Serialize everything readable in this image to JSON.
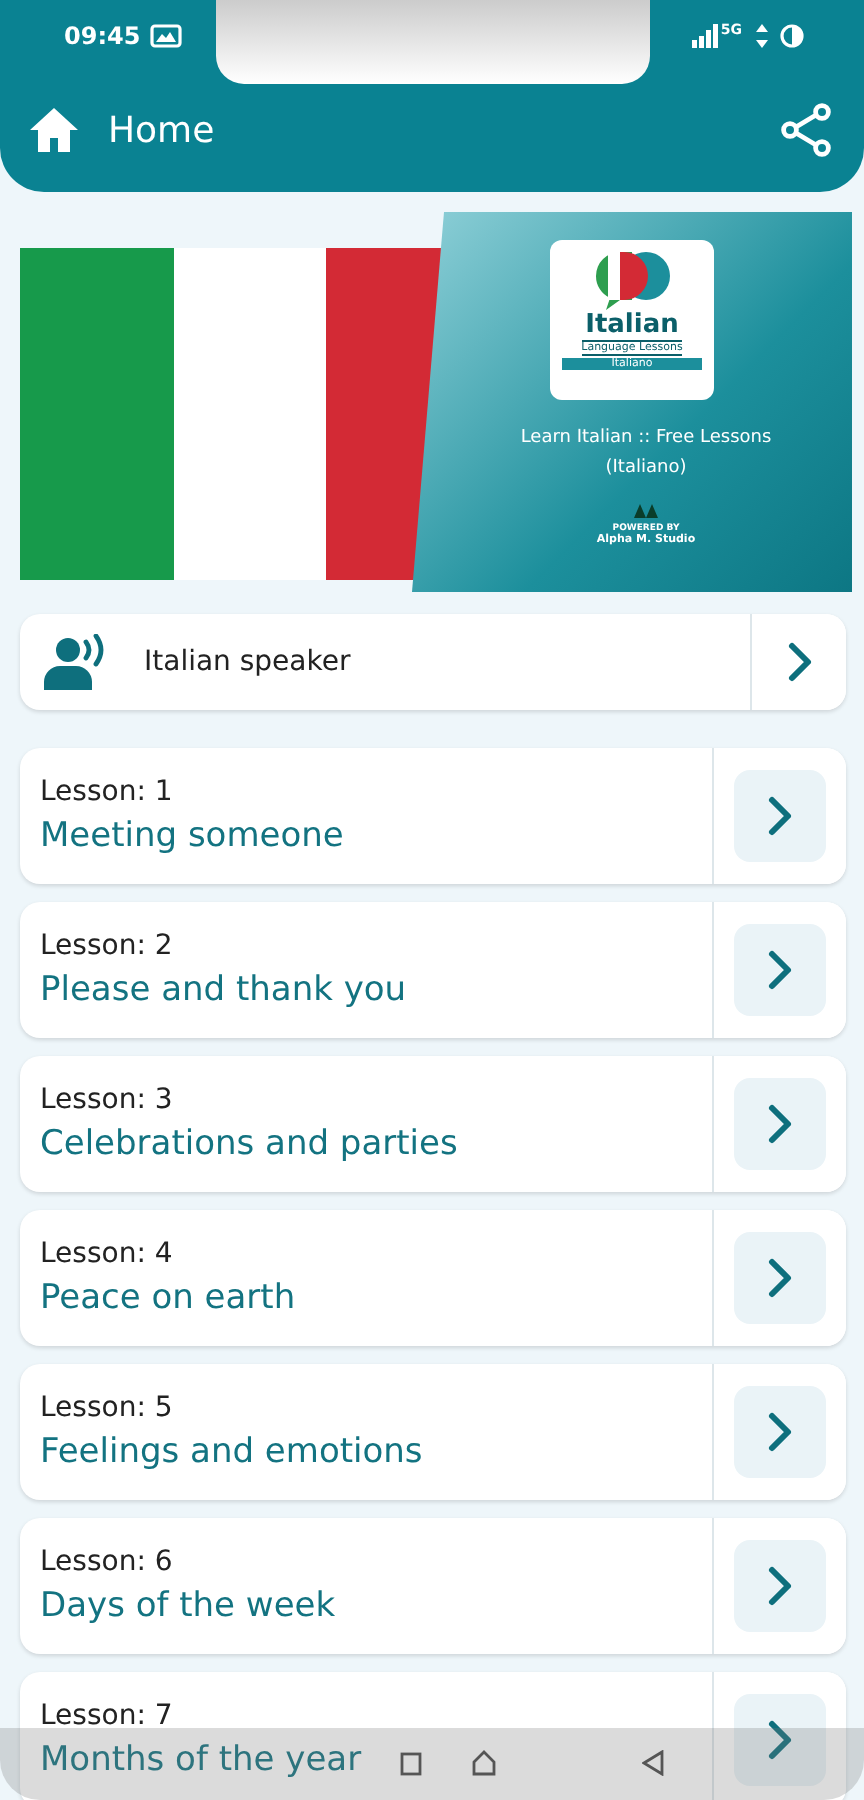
{
  "status_bar": {
    "time": "09:45",
    "network": "5G"
  },
  "header": {
    "title": "Home"
  },
  "banner": {
    "logo_title": "Italian",
    "logo_subtitle": "Language Lessons",
    "logo_tag": "Italiano",
    "headline": "Learn Italian :: Free Lessons (Italiano)",
    "powered_by": "POWERED BY",
    "studio": "Alpha M. Studio"
  },
  "speaker": {
    "label": "Italian speaker"
  },
  "lessons": [
    {
      "number": "Lesson: 1",
      "title": "Meeting someone"
    },
    {
      "number": "Lesson: 2",
      "title": "Please and thank you"
    },
    {
      "number": "Lesson: 3",
      "title": "Celebrations and parties"
    },
    {
      "number": "Lesson: 4",
      "title": "Peace on earth"
    },
    {
      "number": "Lesson: 5",
      "title": "Feelings and emotions"
    },
    {
      "number": "Lesson: 6",
      "title": "Days of the week"
    },
    {
      "number": "Lesson: 7",
      "title": "Months of the year"
    }
  ]
}
